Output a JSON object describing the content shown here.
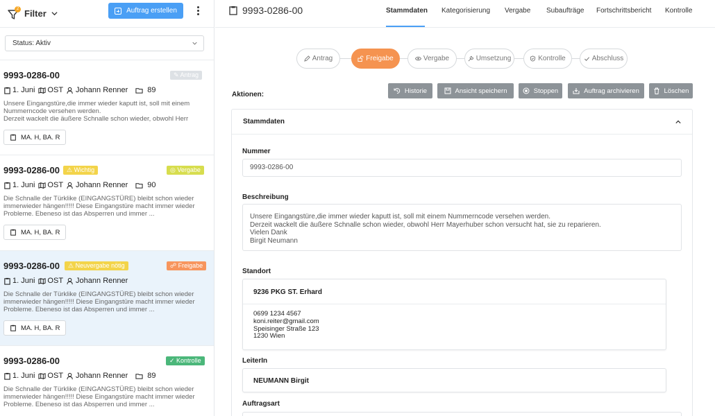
{
  "sidebar": {
    "filter_label": "Filter",
    "filter_count": "2",
    "create_label": "Auftrag erstellen",
    "status_select": "Status: Aktiv",
    "cards": [
      {
        "number": "9993-0286-00",
        "status": "Antrag",
        "warning": "",
        "date": "1. Juni",
        "region": "OST",
        "person": "Johann Renner",
        "count": "89",
        "description": "Unsere Eingangstüre,die immer wieder kaputt ist, soll mit einem Nummerncode versehen werden.\nDerzeit wackelt die äußere Schnalle schon wieder, obwohl Herr",
        "tag": "MA. H, BA. R"
      },
      {
        "number": "9993-0286-00",
        "status": "Vergabe",
        "warning": "Wichtig",
        "date": "1. Juni",
        "region": "OST",
        "person": "Johann Renner",
        "count": "90",
        "description": "Die Schnalle der Türklike (EINGANGSTÜRE) bleibt schon wieder immerwieder hängen!!!!! Diese Eingangstüre macht immer wieder Probleme. Ebeneso ist das Absperren und immer ...",
        "tag": "MA. H, BA. R"
      },
      {
        "number": "9993-0286-00",
        "status": "Freigabe",
        "warning": "Neuvergabe nötig",
        "date": "1. Juni",
        "region": "OST",
        "person": "Johann Renner",
        "count": "",
        "description": "Die Schnalle der Türklike (EINGANGSTÜRE) bleibt schon wieder immerwieder hängen!!!!! Diese Eingangstüre macht immer wieder Probleme. Ebeneso ist das Absperren und immer ...",
        "tag": "MA. H, BA. R"
      },
      {
        "number": "9993-0286-00",
        "status": "Kontrolle",
        "warning": "",
        "date": "1. Juni",
        "region": "OST",
        "person": "Johann Renner",
        "count": "89",
        "description": "Die Schnalle der Türklike (EINGANGSTÜRE) bleibt schon wieder immerwieder hängen!!!!! Diese Eingangstüre macht immer wieder Probleme. Ebeneso ist das Absperren und immer ...",
        "tag": ""
      }
    ]
  },
  "header": {
    "title": "9993-0286-00",
    "tabs": [
      "Stammdaten",
      "Kategorisierung",
      "Vergabe",
      "Subaufträge",
      "Fortschrittsbericht",
      "Kontrolle"
    ],
    "active_tab": "Stammdaten"
  },
  "workflow": {
    "steps": [
      "Antrag",
      "Freigabe",
      "Vergabe",
      "Umsetzung",
      "Kontrolle",
      "Abschluss"
    ],
    "active": "Freigabe"
  },
  "actions": {
    "label": "Aktionen:",
    "buttons": [
      "Historie",
      "Ansicht speichern",
      "Stoppen",
      "Auftrag archivieren",
      "Löschen"
    ]
  },
  "stammdaten": {
    "section_title": "Stammdaten",
    "nummer_label": "Nummer",
    "nummer_value": "9993-0286-00",
    "beschreibung_label": "Beschreibung",
    "beschreibung_lines": [
      "Unsere Eingangstüre,die immer wieder kaputt ist, soll mit einem Nummerncode versehen werden.",
      "Derzeit wackelt die äußere Schnalle schon wieder, obwohl Herr Mayerhuber schon versucht hat, sie zu reparieren.",
      "Vielen Dank",
      "Birgit Neumann"
    ],
    "standort_label": "Standort",
    "standort_name": "9236 PKG ST. Erhard",
    "standort_lines": [
      "0699 1234 4567",
      "koni.reiter@gmail.com",
      "Speisinger Straße 123",
      "1230 Wien"
    ],
    "leiterin_label": "LeiterIn",
    "leiterin_value": "NEUMANN Birgit",
    "auftragsart_label": "Auftragsart"
  },
  "colors": {
    "primary": "#4a9ff5",
    "accent_orange": "#f59350",
    "action_gray": "#8d9398",
    "active_card_bg": "#eaf3fb"
  }
}
